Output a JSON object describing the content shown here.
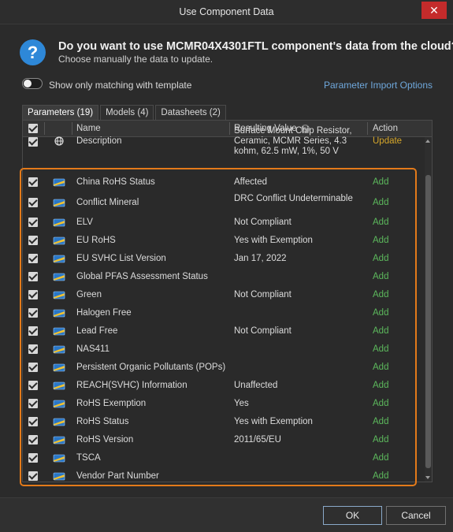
{
  "window": {
    "title": "Use Component Data",
    "close_glyph": "✕"
  },
  "header": {
    "icon": "question-icon",
    "icon_glyph": "?",
    "question": "Do you want to use MCMR04X4301FTL component's data from the cloud?",
    "subtitle": "Choose manually the data to update."
  },
  "options": {
    "toggle_label": "Show only matching with template",
    "toggle_on": false,
    "import_link": "Parameter Import Options"
  },
  "tabs": [
    {
      "label": "Parameters (19)",
      "active": true
    },
    {
      "label": "Models (4)",
      "active": false
    },
    {
      "label": "Datasheets (2)",
      "active": false
    }
  ],
  "table": {
    "headers": {
      "name": "Name",
      "value": "Resulting Value",
      "action": "Action",
      "info_glyph": "?"
    },
    "rows": [
      {
        "icon": "globe-icon",
        "name": "Description",
        "value": "Surface Mount Chip Resistor, Ceramic, MCMR Series, 4.3 kohm, 62.5 mW, 1%, 50 V",
        "action": "Update"
      },
      {
        "icon": "chip-icon",
        "name": "China RoHS Status",
        "value": "Affected",
        "action": "Add"
      },
      {
        "icon": "chip-icon",
        "name": "Conflict Mineral",
        "value": "DRC Conflict Undeterminable",
        "action": "Add"
      },
      {
        "icon": "chip-icon",
        "name": "ELV",
        "value": "Not Compliant",
        "action": "Add"
      },
      {
        "icon": "chip-icon",
        "name": "EU RoHS",
        "value": "Yes with Exemption",
        "action": "Add"
      },
      {
        "icon": "chip-icon",
        "name": "EU SVHC List Version",
        "value": "Jan 17, 2022",
        "action": "Add"
      },
      {
        "icon": "chip-icon",
        "name": "Global PFAS Assessment Status",
        "value": "",
        "action": "Add"
      },
      {
        "icon": "chip-icon",
        "name": "Green",
        "value": "Not Compliant",
        "action": "Add"
      },
      {
        "icon": "chip-icon",
        "name": "Halogen Free",
        "value": "",
        "action": "Add"
      },
      {
        "icon": "chip-icon",
        "name": "Lead Free",
        "value": "Not Compliant",
        "action": "Add"
      },
      {
        "icon": "chip-icon",
        "name": "NAS411",
        "value": "",
        "action": "Add"
      },
      {
        "icon": "chip-icon",
        "name": "Persistent Organic Pollutants (POPs)",
        "value": "",
        "action": "Add"
      },
      {
        "icon": "chip-icon",
        "name": "REACH(SVHC) Information",
        "value": "Unaffected",
        "action": "Add"
      },
      {
        "icon": "chip-icon",
        "name": "RoHS Exemption",
        "value": "Yes",
        "action": "Add"
      },
      {
        "icon": "chip-icon",
        "name": "RoHS Status",
        "value": "Yes with Exemption",
        "action": "Add"
      },
      {
        "icon": "chip-icon",
        "name": "RoHS Version",
        "value": "2011/65/EU",
        "action": "Add"
      },
      {
        "icon": "chip-icon",
        "name": "TSCA",
        "value": "",
        "action": "Add"
      },
      {
        "icon": "chip-icon",
        "name": "Vendor Part Number",
        "value": "",
        "action": "Add"
      }
    ]
  },
  "buttons": {
    "ok": "OK",
    "cancel": "Cancel"
  },
  "colors": {
    "accent": "#2e88d8",
    "add": "#5cb85c",
    "update": "#d6a72b",
    "highlight": "#e37a1a",
    "close": "#c42b2b"
  }
}
